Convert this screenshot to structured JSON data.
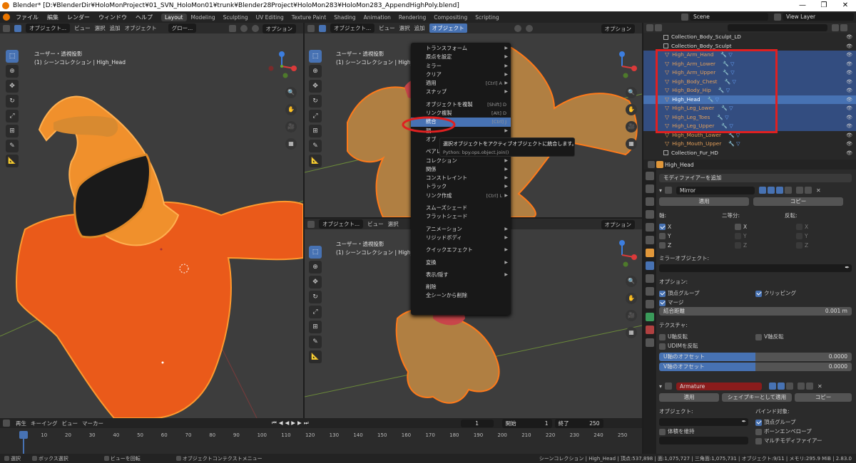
{
  "window": {
    "title": "Blender* [D:¥BlenderDir¥HoloMonProject¥01_SVN_HoloMon01¥trunk¥Blender28Project¥HoloMon283¥HoloMon283_AppendHighPoly.blend]",
    "min": "—",
    "max": "❐",
    "close": "✕"
  },
  "topbar": {
    "menus": [
      "ファイル",
      "編集",
      "レンダー",
      "ウィンドウ",
      "ヘルプ"
    ],
    "workspaces": [
      "Layout",
      "Modeling",
      "Sculpting",
      "UV Editing",
      "Texture Paint",
      "Shading",
      "Animation",
      "Rendering",
      "Compositing",
      "Scripting"
    ],
    "scene_label": "Scene",
    "view_layer_label": "View Layer"
  },
  "viewport": {
    "mode": "オブジェクト...",
    "orient": "グロー...",
    "view": "ビュー",
    "select": "選択",
    "add": "追加",
    "object": "オブジェクト",
    "options": "オプション",
    "info_line1": "ユーザー・透視投影",
    "info_line2": "(1) シーンコレクション | High_Head",
    "info_short": "(1) シーンコレクション | High_Hea"
  },
  "context_menu": {
    "items": [
      {
        "label": "トランスフォーム",
        "shortcut": "",
        "sub": true
      },
      {
        "label": "原点を設定",
        "shortcut": "",
        "sub": true
      },
      {
        "label": "ミラー",
        "shortcut": "",
        "sub": true
      },
      {
        "label": "クリア",
        "shortcut": "",
        "sub": true
      },
      {
        "label": "適用",
        "shortcut": "[Ctrl] A",
        "sub": true
      },
      {
        "label": "スナップ",
        "shortcut": "",
        "sub": true
      },
      {
        "sep": true
      },
      {
        "label": "オブジェクトを複製",
        "shortcut": "[Shift] D",
        "sub": false
      },
      {
        "label": "リンク複製",
        "shortcut": "[Alt] D",
        "sub": false
      },
      {
        "label": "統合",
        "shortcut": "[Ctrl] J",
        "sub": false,
        "hl": true
      },
      {
        "label": "親",
        "shortcut": "",
        "sub": true
      },
      {
        "label": "オブ",
        "shortcut": "",
        "sub": true
      },
      {
        "sep": true
      },
      {
        "label": "ペアレント",
        "shortcut": "",
        "sub": true
      },
      {
        "label": "コレクション",
        "shortcut": "",
        "sub": true
      },
      {
        "label": "関係",
        "shortcut": "",
        "sub": true
      },
      {
        "label": "コンストレイント",
        "shortcut": "",
        "sub": true
      },
      {
        "label": "トラック",
        "shortcut": "",
        "sub": true
      },
      {
        "label": "リンク作成",
        "shortcut": "[Ctrl] L",
        "sub": true
      },
      {
        "sep": true
      },
      {
        "label": "スムーズシェード",
        "shortcut": "",
        "sub": false
      },
      {
        "label": "フラットシェード",
        "shortcut": "",
        "sub": false
      },
      {
        "sep": true
      },
      {
        "label": "アニメーション",
        "shortcut": "",
        "sub": true
      },
      {
        "label": "リジッドボディ",
        "shortcut": "",
        "sub": true
      },
      {
        "sep": true
      },
      {
        "label": "クイックエフェクト",
        "shortcut": "",
        "sub": true
      },
      {
        "sep": true
      },
      {
        "label": "変換",
        "shortcut": "",
        "sub": true
      },
      {
        "sep": true
      },
      {
        "label": "表示/隠す",
        "shortcut": "",
        "sub": true
      },
      {
        "sep": true
      },
      {
        "label": "削除",
        "shortcut": "",
        "sub": false
      },
      {
        "label": "全シーンから削除",
        "shortcut": "",
        "sub": false
      }
    ]
  },
  "tooltip": {
    "line1": "選択オブジェクトをアクティブオブジェクトに統合します。",
    "line2": "Python: bpy.ops.object.join()"
  },
  "outliner": {
    "rows": [
      {
        "name": "Collection_Body_Sculpt_LD",
        "type": "collection",
        "state": "plain"
      },
      {
        "name": "Collection_Body_Sculpt",
        "type": "collection",
        "state": "plain"
      },
      {
        "name": "High_Arm_Hand",
        "type": "object",
        "state": "sel"
      },
      {
        "name": "High_Arm_Lower",
        "type": "object",
        "state": "sel"
      },
      {
        "name": "High_Arm_Upper",
        "type": "object",
        "state": "sel"
      },
      {
        "name": "High_Body_Chest",
        "type": "object",
        "state": "sel"
      },
      {
        "name": "High_Body_Hip",
        "type": "object",
        "state": "sel"
      },
      {
        "name": "High_Head",
        "type": "object",
        "state": "active"
      },
      {
        "name": "High_Leg_Lower",
        "type": "object",
        "state": "sel"
      },
      {
        "name": "High_Leg_Toes",
        "type": "object",
        "state": "sel"
      },
      {
        "name": "High_Leg_Upper",
        "type": "object",
        "state": "sel"
      },
      {
        "name": "High_Mouth_Lower",
        "type": "object",
        "state": "plain"
      },
      {
        "name": "High_Mouth_Upper",
        "type": "object",
        "state": "plain"
      },
      {
        "name": "Collection_Fur_HD",
        "type": "collection",
        "state": "plain"
      }
    ]
  },
  "properties": {
    "object_name": "High_Head",
    "add_modifier": "モディファイアーを追加",
    "mirror": {
      "name": "Mirror",
      "apply": "適用",
      "copy": "コピー",
      "axis": "軸:",
      "bisect": "二等分:",
      "flip": "反転:",
      "x": "X",
      "y": "Y",
      "z": "Z",
      "mirror_object": "ミラーオブジェクト:",
      "options": "オプション:",
      "vgroups": "頂点グループ",
      "clipping": "クリッピング",
      "merge": "マージ",
      "merge_dist_label": "結合距離",
      "merge_dist": "0.001 m",
      "texture": "テクスチャ:",
      "u_flip": "U軸反転",
      "v_flip": "V軸反転",
      "udim_flip": "UDIMを反転",
      "u_offset_label": "U軸のオフセット",
      "u_offset": "0.0000",
      "v_offset_label": "V軸のオフセット",
      "v_offset": "0.0000"
    },
    "armature": {
      "name": "Armature",
      "apply": "適用",
      "shape_apply": "シェイプキーとして適用",
      "copy": "コピー",
      "object_label": "オブジェクト:",
      "bind_label": "バインド対象:",
      "preserve_volume": "体積を維持",
      "vgroups": "頂点グループ",
      "bone_env": "ボーンエンベロープ",
      "multi_mod": "マルチモディファイアー"
    }
  },
  "timeline": {
    "playback": "再生",
    "keying": "キーイング",
    "view": "ビュー",
    "marker": "マーカー",
    "current": "1",
    "start_label": "開始",
    "start": "1",
    "end_label": "終了",
    "end": "250",
    "ticks": [
      "1",
      "10",
      "20",
      "30",
      "40",
      "50",
      "60",
      "70",
      "80",
      "90",
      "100",
      "110",
      "120",
      "130",
      "140",
      "150",
      "160",
      "170",
      "180",
      "190",
      "200",
      "210",
      "220",
      "230",
      "240",
      "250"
    ]
  },
  "statusbar": {
    "select": "選択",
    "box": "ボックス選択",
    "rotate": "ビューを回転",
    "ctx": "オブジェクトコンテクストメニュー",
    "stats": "シーンコレクション | High_Head | 頂点:537,898 | 面:1,075,727 | 三角面:1,075,731 | オブジェクト:9/11 | メモリ:295.9 MiB | 2.83.0"
  }
}
